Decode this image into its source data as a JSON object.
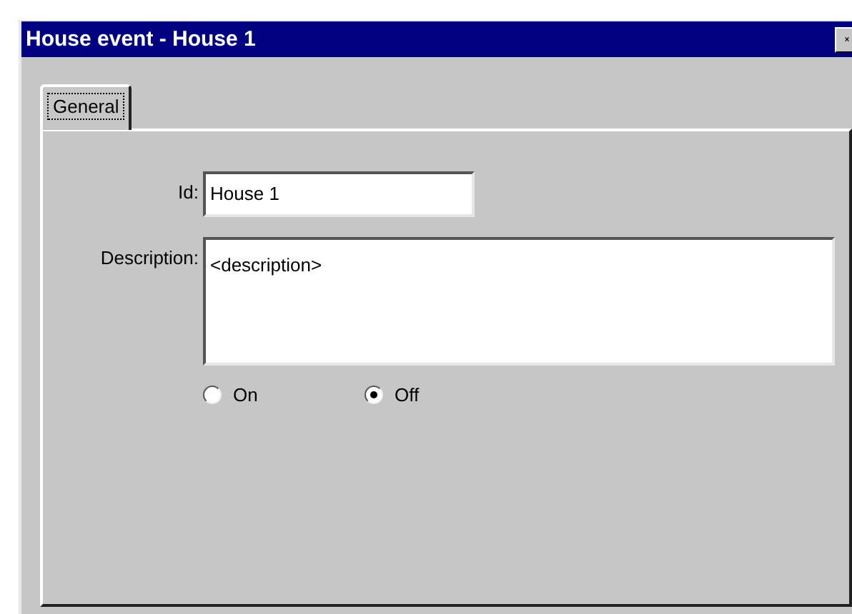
{
  "window": {
    "title": "House event - House 1"
  },
  "tabs": [
    {
      "label": "General",
      "selected": true
    }
  ],
  "fields": [
    {
      "kind": "line",
      "label": "Id:",
      "value": "House 1"
    },
    {
      "kind": "area",
      "label": "Description:",
      "value": "<description>"
    }
  ],
  "options": [
    {
      "label": "On",
      "selected": false
    },
    {
      "label": "Off",
      "selected": true
    }
  ]
}
